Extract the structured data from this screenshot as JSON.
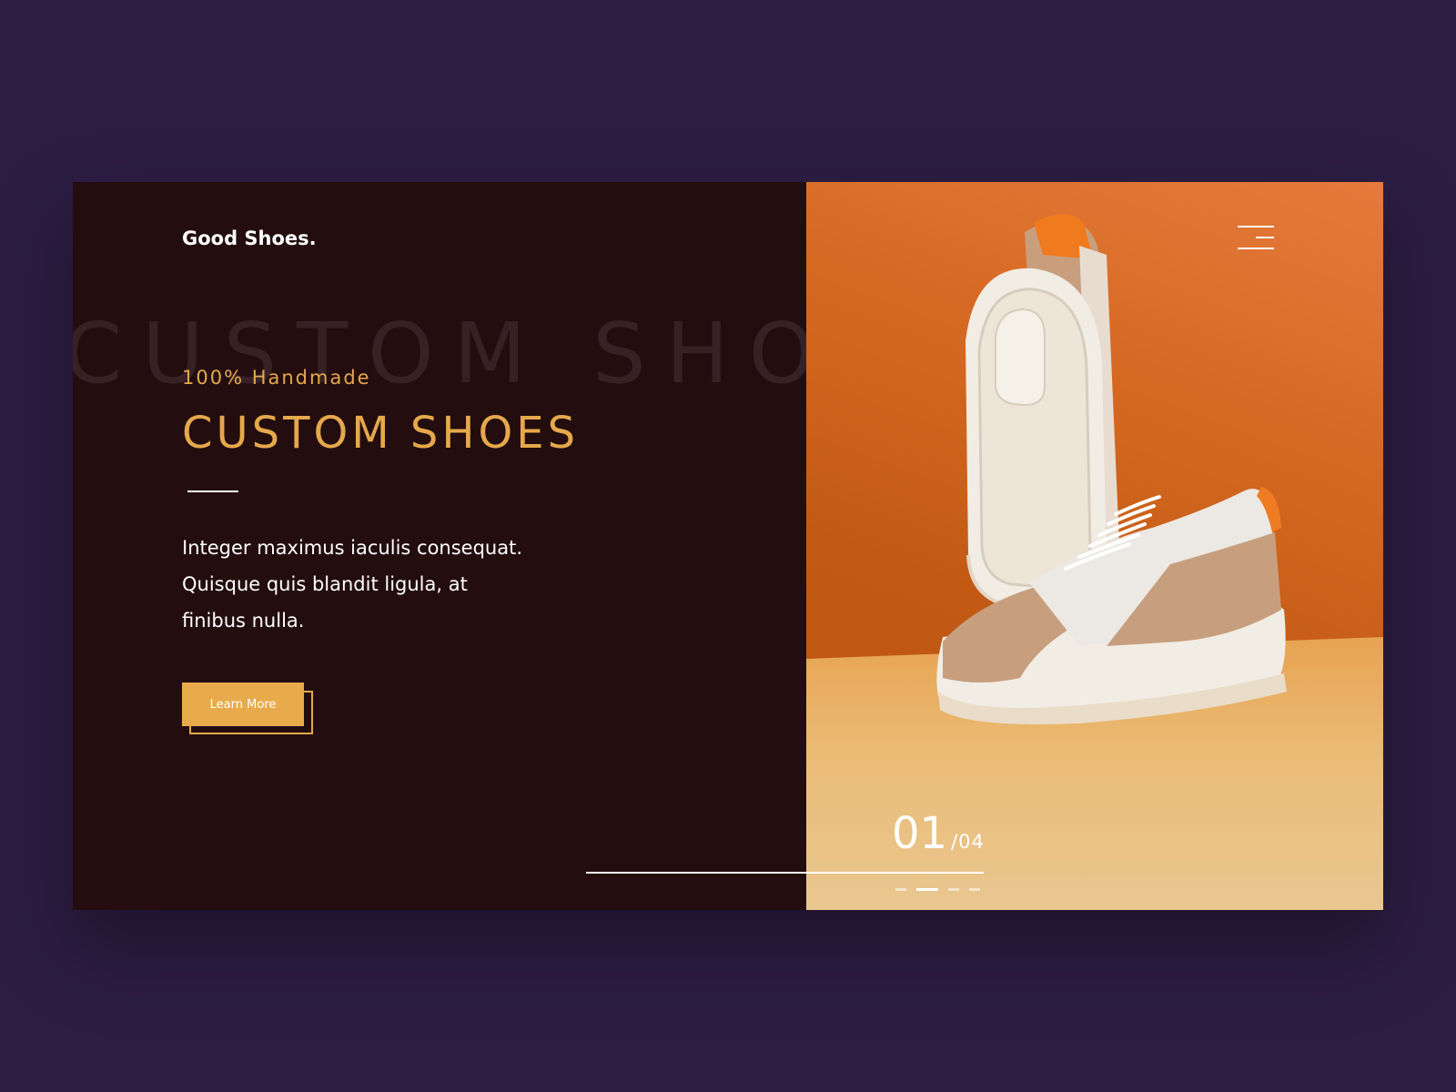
{
  "brand": {
    "name": "Good Shoes."
  },
  "hero": {
    "background_word": "CUSTOM SHOES",
    "eyebrow": "100% Handmade",
    "title": "CUSTOM SHOES",
    "description": "Integer maximus iaculis consequat. Quisque quis blandit ligula, at finibus nulla.",
    "cta_label": "Learn More"
  },
  "slider": {
    "current": "01",
    "total": "/04",
    "active_index": 1,
    "slide_count": 4
  },
  "icons": {
    "menu": "hamburger-menu-icon"
  },
  "colors": {
    "page_background": "#2d1d43",
    "panel_background": "#230d0f",
    "accent": "#e5a84b",
    "text": "#ffffff"
  }
}
